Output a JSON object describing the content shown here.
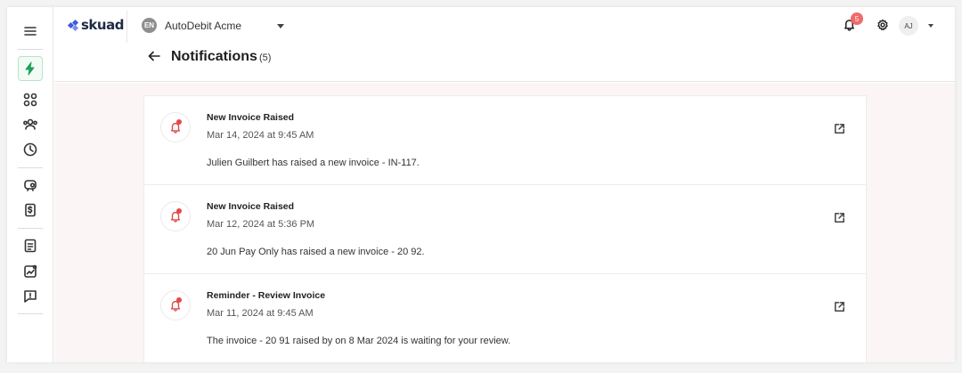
{
  "brand": {
    "name": "skuad"
  },
  "org": {
    "initials": "EN",
    "name": "AutoDebit Acme"
  },
  "header": {
    "notification_count": "5",
    "user_initials": "AJ"
  },
  "page": {
    "title": "Notifications",
    "count": "(5)"
  },
  "sidebar": {
    "items": [
      {
        "icon": "menu-icon"
      },
      {
        "icon": "lightning-icon"
      },
      {
        "icon": "dashboard-grid-icon"
      },
      {
        "icon": "people-icon"
      },
      {
        "icon": "clock-icon"
      },
      {
        "icon": "payroll-icon"
      },
      {
        "icon": "invoice-dollar-icon"
      },
      {
        "icon": "document-icon"
      },
      {
        "icon": "analytics-icon"
      },
      {
        "icon": "feedback-icon"
      }
    ]
  },
  "notifications": [
    {
      "title": "New Invoice Raised",
      "date": "Mar 14, 2024 at 9:45 AM",
      "message": "Julien Guilbert has raised a new invoice - IN-117."
    },
    {
      "title": "New Invoice Raised",
      "date": "Mar 12, 2024 at 5:36 PM",
      "message": "20 Jun Pay Only has raised a new invoice - 20 92."
    },
    {
      "title": "Reminder - Review Invoice",
      "date": "Mar 11, 2024 at 9:45 AM",
      "message": "The invoice - 20 91 raised by on 8 Mar 2024 is waiting for your review."
    }
  ],
  "colors": {
    "accent_green": "#1aa155",
    "alert_red": "#e24a4a",
    "brand_blue": "#3b5bdb"
  }
}
